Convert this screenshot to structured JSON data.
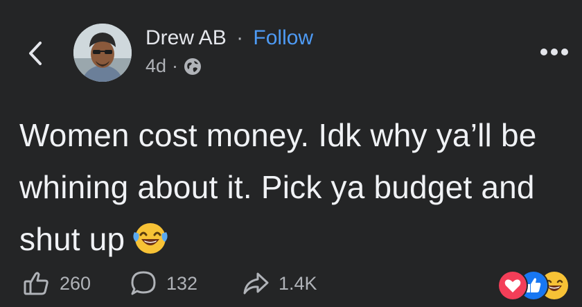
{
  "header": {
    "back_icon": "chevron-left-icon",
    "author_name": "Drew AB",
    "separator": "·",
    "follow_label": "Follow",
    "timestamp": "4d",
    "meta_separator": "·",
    "audience_icon": "globe-icon",
    "more_icon": "ellipsis-icon"
  },
  "post": {
    "text": "Women cost money. Idk why ya’ll be whining about it. Pick ya budget and shut up",
    "emoji": "laughing-tears-emoji"
  },
  "actions": {
    "like_count": "260",
    "comment_count": "132",
    "share_count": "1.4K"
  },
  "reactions": [
    "love",
    "like",
    "haha"
  ],
  "colors": {
    "background": "#242526",
    "text": "#e4e6eb",
    "muted": "#b0b3b8",
    "link": "#4e9bf5"
  }
}
